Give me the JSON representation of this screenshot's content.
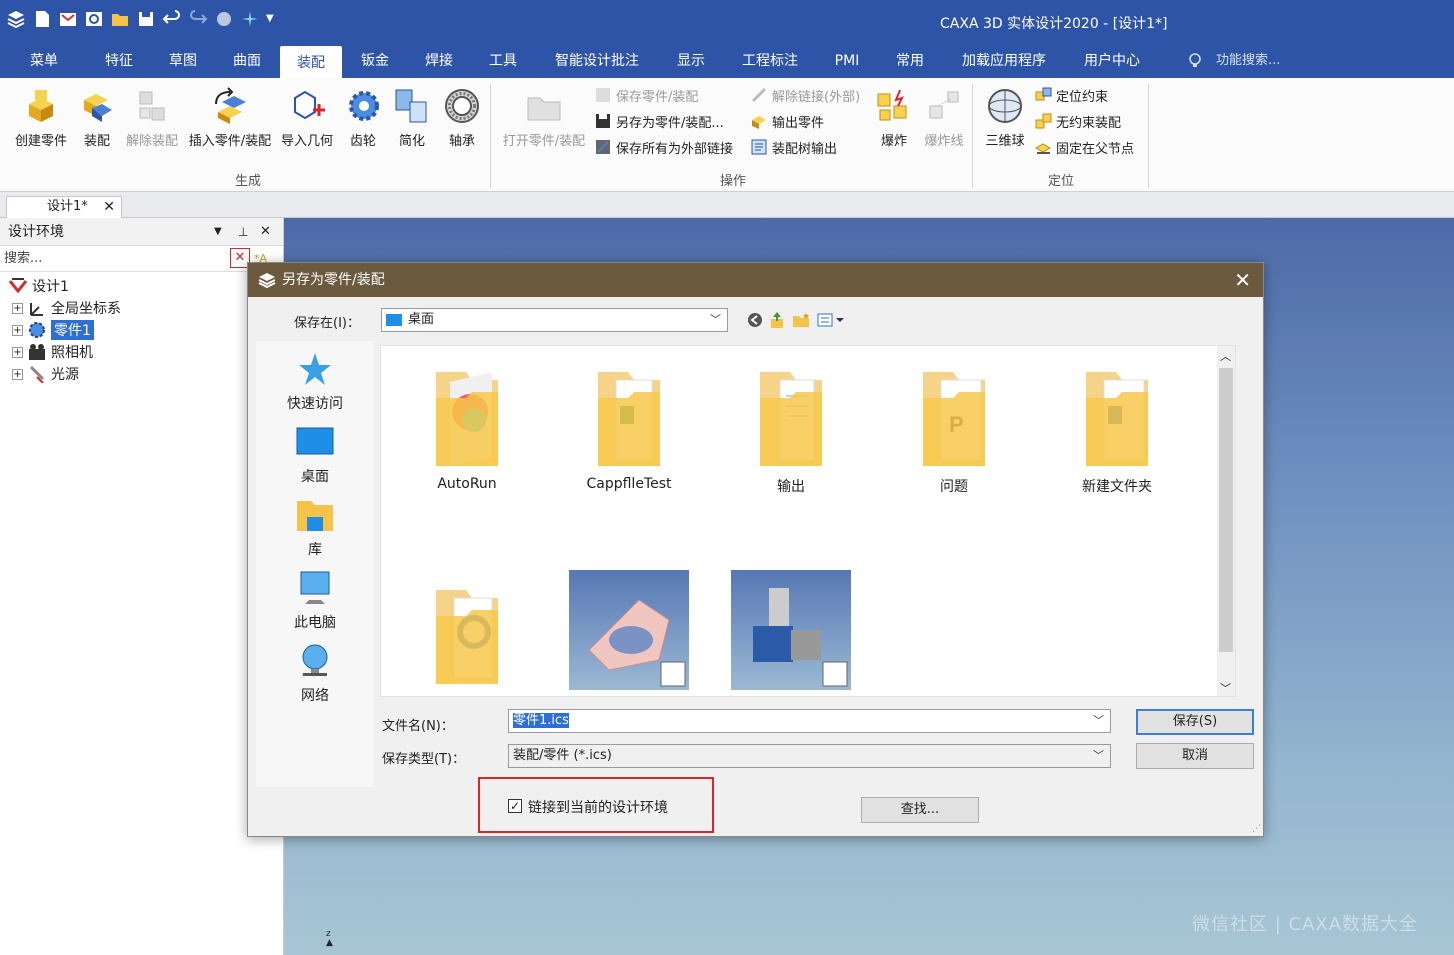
{
  "window": {
    "title": "CAXA 3D 实体设计2020 - [设计1*]"
  },
  "menubar": {
    "tabs": [
      "菜单",
      "特征",
      "草图",
      "曲面",
      "装配",
      "钣金",
      "焊接",
      "工具",
      "智能设计批注",
      "显示",
      "工程标注",
      "PMI",
      "常用",
      "加载应用程序",
      "用户中心"
    ],
    "active": "装配",
    "search_hint": "功能搜索..."
  },
  "ribbon": {
    "generate": {
      "group_label": "生成",
      "buttons": [
        "创建零件",
        "装配",
        "解除装配",
        "插入零件/装配",
        "导入几何",
        "齿轮",
        "简化",
        "轴承"
      ]
    },
    "operate": {
      "group_label": "操作",
      "open_label": "打开零件/装配",
      "small": [
        "保存零件/装配",
        "另存为零件/装配...",
        "保存所有为外部链接",
        "解除链接(外部)",
        "输出零件",
        "装配树输出"
      ],
      "explode": "爆炸",
      "explode_line": "爆炸线"
    },
    "locate": {
      "group_label": "定位",
      "ball": "三维球",
      "small": [
        "定位约束",
        "无约束装配",
        "固定在父节点"
      ]
    }
  },
  "doc_tab": {
    "label": "设计1*"
  },
  "left_panel": {
    "title": "设计环境",
    "search_placeholder": "搜索...",
    "tree": {
      "root": "设计1",
      "children": [
        "全局坐标系",
        "零件1",
        "照相机",
        "光源"
      ]
    }
  },
  "dialog": {
    "title": "另存为零件/装配",
    "save_in_label": "保存在(I)：",
    "save_in_value": "桌面",
    "places": [
      "快速访问",
      "桌面",
      "库",
      "此电脑",
      "网络"
    ],
    "files": [
      "AutoRun",
      "CappflleTest",
      "输出",
      "问题",
      "新建文件夹"
    ],
    "filename_label": "文件名(N)：",
    "filename_value": "零件1.ics",
    "filetype_label": "保存类型(T)：",
    "filetype_value": "装配/零件 (*.ics)",
    "save_button": "保存(S)",
    "cancel_button": "取消",
    "link_checkbox": "链接到当前的设计环境",
    "link_checked": true,
    "find_button": "查找..."
  },
  "colors": {
    "title_blue": "#2e54a8",
    "dialog_title": "#6b5a3e",
    "highlight": "#d8262c"
  },
  "watermark": "微信社区 | CAXA数据大全"
}
